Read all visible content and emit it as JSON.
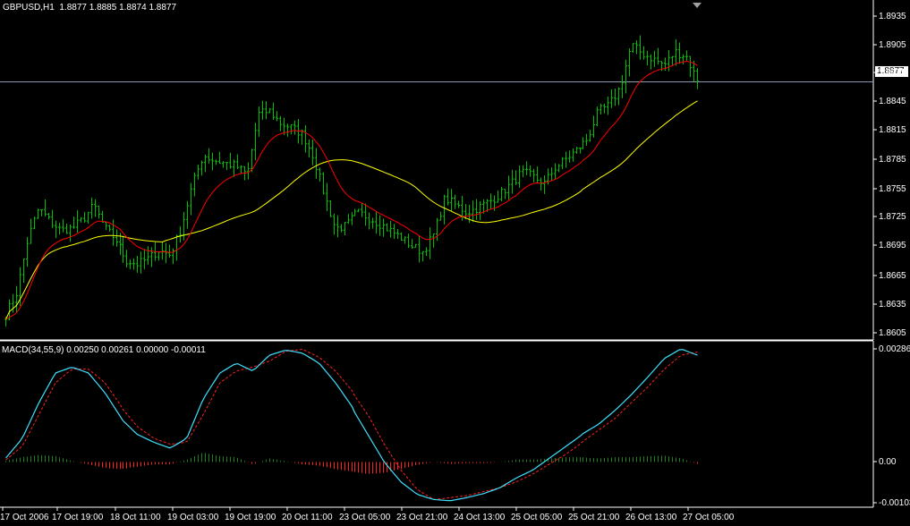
{
  "chart_data": [
    {
      "type": "candlestick",
      "title": "GBPUSD,H1",
      "ohlc_label": "1.8877 1.8885 1.8874 1.8877",
      "current_price_label": "1.8877",
      "current_price": 1.8877,
      "ylim": [
        1.8595,
        1.895
      ],
      "y_ticks": [
        "1.8935",
        "1.8905",
        "1.8875",
        "1.8845",
        "1.8815",
        "1.8785",
        "1.8755",
        "1.8725",
        "1.8695",
        "1.8665",
        "1.8635",
        "1.8605"
      ],
      "x_ticks": [
        "17 Oct 2006",
        "17 Oct 19:00",
        "18 Oct 11:00",
        "19 Oct 03:00",
        "19 Oct 19:00",
        "20 Oct 11:00",
        "23 Oct 05:00",
        "23 Oct 21:00",
        "24 Oct 13:00",
        "25 Oct 05:00",
        "25 Oct 21:00",
        "26 Oct 13:00",
        "27 Oct 05:00"
      ],
      "colors": {
        "bars": "#00c000",
        "ma_fast": "#ff0000",
        "ma_slow": "#ffff00",
        "grid": "#ffffff",
        "background": "#000000"
      },
      "price_path": [
        1.8615,
        1.864,
        1.87,
        1.8735,
        1.872,
        1.871,
        1.8712,
        1.8722,
        1.8738,
        1.8712,
        1.87,
        1.8676,
        1.8672,
        1.8678,
        1.8688,
        1.8682,
        1.8712,
        1.876,
        1.8794,
        1.8788,
        1.8785,
        1.8782,
        1.8772,
        1.884,
        1.8844,
        1.883,
        1.8825,
        1.8818,
        1.8793,
        1.875,
        1.8712,
        1.8715,
        1.873,
        1.8725,
        1.8718,
        1.871,
        1.8702,
        1.8692,
        1.8686,
        1.8705,
        1.8746,
        1.8738,
        1.873,
        1.8735,
        1.8742,
        1.875,
        1.8762,
        1.8775,
        1.877,
        1.8762,
        1.878,
        1.879,
        1.88,
        1.8812,
        1.8843,
        1.885,
        1.887,
        1.8918,
        1.8908,
        1.8902,
        1.8895,
        1.891,
        1.8905,
        1.8877
      ]
    },
    {
      "type": "line",
      "title": "MACD(34,55,9) 0.00250 0.00261 0.00000 -0.00011",
      "ylim": [
        -0.00103,
        0.00286
      ],
      "y_ticks": [
        "0.00286",
        "0.00",
        "-0.00103"
      ],
      "colors": {
        "macd": "#40e0ff",
        "signal": "#ff2020",
        "hist_pos": "#208020",
        "hist_neg": "#ff2020"
      },
      "macd_path": [
        0.0001,
        0.0006,
        0.0015,
        0.00225,
        0.0024,
        0.00225,
        0.00175,
        0.0011,
        0.0007,
        0.0005,
        0.00035,
        0.0006,
        0.0016,
        0.00225,
        0.0025,
        0.0023,
        0.0027,
        0.00283,
        0.00275,
        0.0025,
        0.002,
        0.0014,
        0.0007,
        0.0,
        -0.0005,
        -0.00082,
        -0.00095,
        -0.00098,
        -0.0009,
        -0.0008,
        -0.00065,
        -0.0004,
        -0.0002,
        0.0001,
        0.0004,
        0.0007,
        0.00095,
        0.0013,
        0.0017,
        0.00215,
        0.00262,
        0.00286,
        0.0027
      ],
      "signal_path": [
        5e-05,
        0.0004,
        0.0012,
        0.002,
        0.00235,
        0.00235,
        0.002,
        0.0014,
        0.0009,
        0.0006,
        0.00045,
        0.0005,
        0.0012,
        0.002,
        0.0023,
        0.0024,
        0.00255,
        0.0028,
        0.00285,
        0.00265,
        0.0023,
        0.0018,
        0.0012,
        0.00045,
        -0.0002,
        -0.0007,
        -0.00095,
        -0.0009,
        -0.00085,
        -0.00075,
        -0.00065,
        -0.0005,
        -0.0003,
        -5e-05,
        0.0002,
        0.0005,
        0.0008,
        0.0011,
        0.0015,
        0.0019,
        0.00235,
        0.0027,
        0.00278
      ]
    }
  ]
}
